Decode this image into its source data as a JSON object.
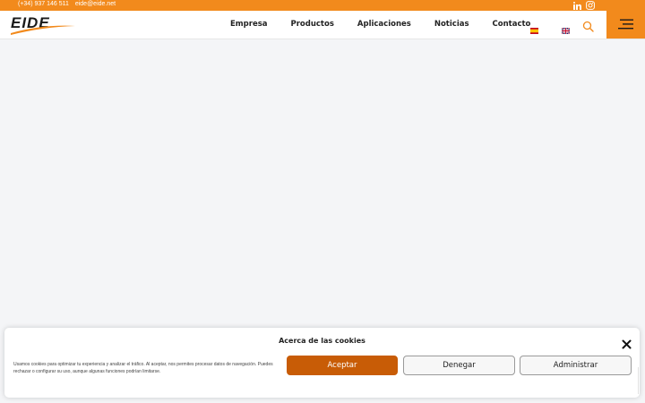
{
  "topbar": {
    "phone": "(+34) 937 146 511",
    "email": "eide@eide.net",
    "social": [
      {
        "icon": "linkedin-icon"
      },
      {
        "icon": "instagram-icon"
      }
    ]
  },
  "header": {
    "logo_text": "EIDE",
    "nav": [
      "Empresa",
      "Productos",
      "Aplicaciones",
      "Noticias",
      "Contacto"
    ],
    "languages": [
      {
        "icon": "spain-flag-icon"
      },
      {
        "icon": "uk-flag-icon"
      }
    ],
    "search_icon": "search-icon",
    "menu_icon": "hamburger-menu-icon"
  },
  "cookie_banner": {
    "title": "Acerca de las cookies",
    "text": "Usamos cookies para optimizar tu experiencia y analizar el tráfico. Al aceptar, nos permites procesar datos de navegación. Puedes rechazar o configurar su uso, aunque algunas funciones podrían limitarse.",
    "buttons": {
      "accept": "Aceptar",
      "deny": "Denegar",
      "manage": "Administrar"
    }
  },
  "colors": {
    "brand_orange": "#f28a1c",
    "accept_button": "#c85c06",
    "page_background": "#f4f5f7"
  }
}
